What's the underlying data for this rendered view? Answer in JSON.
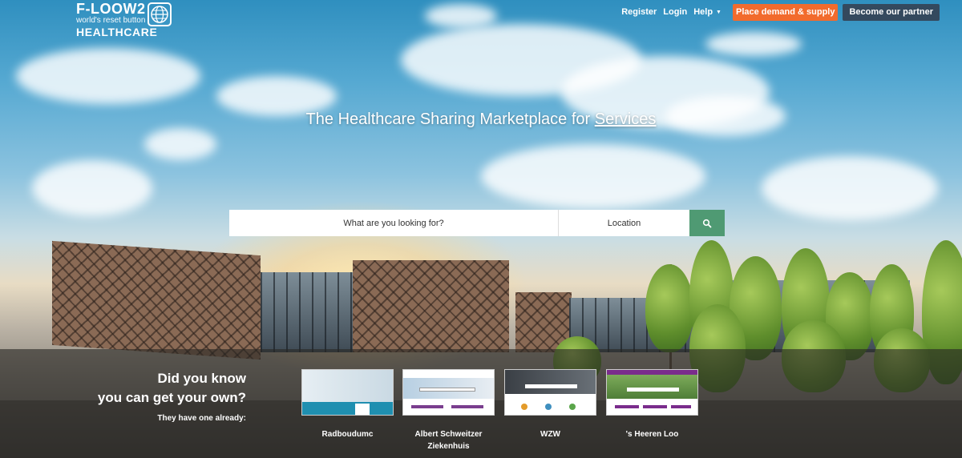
{
  "header": {
    "logo": {
      "brand": "F-LOOW2",
      "tagline": "world's reset button",
      "sub": "HEALTHCARE"
    },
    "nav": {
      "register": "Register",
      "login": "Login",
      "help": "Help",
      "place_demand": "Place demand & supply",
      "become_partner": "Become our partner"
    }
  },
  "hero": {
    "title_prefix": "The Healthcare Sharing Marketplace for ",
    "title_link": "Services"
  },
  "search": {
    "what_placeholder": "What are you looking for?",
    "location_placeholder": "Location",
    "button_icon": "search-icon"
  },
  "promo": {
    "line1": "Did you know",
    "line2": "you can get your own?",
    "subline": "They have one already:",
    "examples": [
      {
        "name": "Radboudumc"
      },
      {
        "name": "Albert Schweitzer Ziekenhuis"
      },
      {
        "name": "WZW"
      },
      {
        "name": "'s Heeren Loo"
      }
    ]
  },
  "colors": {
    "accent_orange": "#f26b2d",
    "partner_navy": "#34495e",
    "search_green": "#4f9a73"
  }
}
